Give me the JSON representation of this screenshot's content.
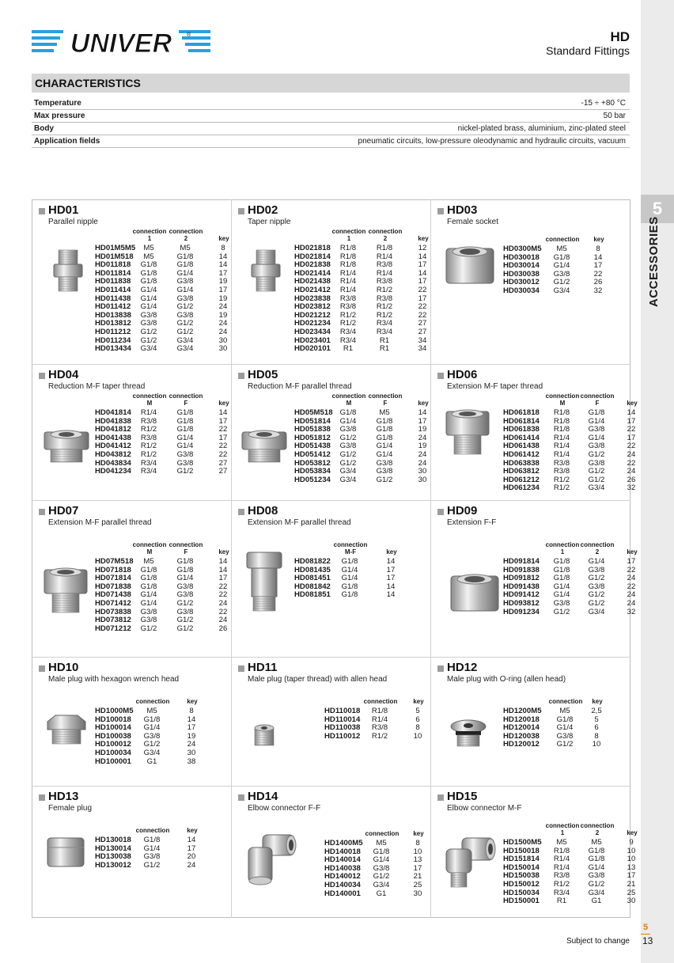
{
  "brand": "UNIVER",
  "header": {
    "series": "HD",
    "subtitle": "Standard Fittings"
  },
  "section_tab": {
    "number": "5",
    "label": "ACCESSORIES"
  },
  "characteristics": {
    "title": "CHARACTERISTICS",
    "rows": [
      {
        "label": "Temperature",
        "value": "-15 ÷ +80 °C"
      },
      {
        "label": "Max pressure",
        "value": "50 bar"
      },
      {
        "label": "Body",
        "value": "nickel-plated brass, aluminium, zinc-plated steel"
      },
      {
        "label": "Application fields",
        "value": "pneumatic circuits, low-pressure oleodynamic and hydraulic circuits, vacuum"
      }
    ]
  },
  "products": [
    {
      "code": "HD01",
      "desc": "Parallel nipple",
      "pic": "nipple",
      "header": [
        "",
        "connection\n1",
        "connection\n2",
        "key"
      ],
      "rows": [
        [
          "HD01M5M5",
          "M5",
          "M5",
          "8"
        ],
        [
          "HD01M518",
          "M5",
          "G1/8",
          "14"
        ],
        [
          "HD011818",
          "G1/8",
          "G1/8",
          "14"
        ],
        [
          "HD011814",
          "G1/8",
          "G1/4",
          "17"
        ],
        [
          "HD011838",
          "G1/8",
          "G3/8",
          "19"
        ],
        [
          "HD011414",
          "G1/4",
          "G1/4",
          "17"
        ],
        [
          "HD011438",
          "G1/4",
          "G3/8",
          "19"
        ],
        [
          "HD011412",
          "G1/4",
          "G1/2",
          "24"
        ],
        [
          "HD013838",
          "G3/8",
          "G3/8",
          "19"
        ],
        [
          "HD013812",
          "G3/8",
          "G1/2",
          "24"
        ],
        [
          "HD011212",
          "G1/2",
          "G1/2",
          "24"
        ],
        [
          "HD011234",
          "G1/2",
          "G3/4",
          "30"
        ],
        [
          "HD013434",
          "G3/4",
          "G3/4",
          "30"
        ]
      ]
    },
    {
      "code": "HD02",
      "desc": "Taper nipple",
      "pic": "nipple",
      "header": [
        "",
        "connection\n1",
        "connection\n2",
        "key"
      ],
      "rows": [
        [
          "HD021818",
          "R1/8",
          "R1/8",
          "12"
        ],
        [
          "HD021814",
          "R1/8",
          "R1/4",
          "14"
        ],
        [
          "HD021838",
          "R1/8",
          "R3/8",
          "17"
        ],
        [
          "HD021414",
          "R1/4",
          "R1/4",
          "14"
        ],
        [
          "HD021438",
          "R1/4",
          "R3/8",
          "17"
        ],
        [
          "HD021412",
          "R1/4",
          "R1/2",
          "22"
        ],
        [
          "HD023838",
          "R3/8",
          "R3/8",
          "17"
        ],
        [
          "HD023812",
          "R3/8",
          "R1/2",
          "22"
        ],
        [
          "HD021212",
          "R1/2",
          "R1/2",
          "22"
        ],
        [
          "HD021234",
          "R1/2",
          "R3/4",
          "27"
        ],
        [
          "HD023434",
          "R3/4",
          "R3/4",
          "27"
        ],
        [
          "HD023401",
          "R3/4",
          "R1",
          "34"
        ],
        [
          "HD020101",
          "R1",
          "R1",
          "34"
        ]
      ]
    },
    {
      "code": "HD03",
      "desc": "Female socket",
      "pic": "socket",
      "header": [
        "",
        "connection",
        "key"
      ],
      "rows": [
        [
          "HD0300M5",
          "M5",
          "8"
        ],
        [
          "HD030018",
          "G1/8",
          "14"
        ],
        [
          "HD030014",
          "G1/4",
          "17"
        ],
        [
          "HD030038",
          "G3/8",
          "22"
        ],
        [
          "HD030012",
          "G1/2",
          "26"
        ],
        [
          "HD030034",
          "G3/4",
          "32"
        ]
      ]
    },
    {
      "code": "HD04",
      "desc": "Reduction M-F taper thread",
      "pic": "reducer",
      "header": [
        "",
        "connection\nM",
        "connection\nF",
        "key"
      ],
      "rows": [
        [
          "HD041814",
          "R1/4",
          "G1/8",
          "14"
        ],
        [
          "HD041838",
          "R3/8",
          "G1/8",
          "17"
        ],
        [
          "HD041812",
          "R1/2",
          "G1/8",
          "22"
        ],
        [
          "HD041438",
          "R3/8",
          "G1/4",
          "17"
        ],
        [
          "HD041412",
          "R1/2",
          "G1/4",
          "22"
        ],
        [
          "HD043812",
          "R1/2",
          "G3/8",
          "22"
        ],
        [
          "HD043834",
          "R3/4",
          "G3/8",
          "27"
        ],
        [
          "HD041234",
          "R3/4",
          "G1/2",
          "27"
        ]
      ]
    },
    {
      "code": "HD05",
      "desc": "Reduction M-F parallel thread",
      "pic": "reducer",
      "header": [
        "",
        "connection\nM",
        "connection\nF",
        "key"
      ],
      "rows": [
        [
          "HD05M518",
          "G1/8",
          "M5",
          "14"
        ],
        [
          "HD051814",
          "G1/4",
          "G1/8",
          "17"
        ],
        [
          "HD051838",
          "G3/8",
          "G1/8",
          "19"
        ],
        [
          "HD051812",
          "G1/2",
          "G1/8",
          "24"
        ],
        [
          "HD051438",
          "G3/8",
          "G1/4",
          "19"
        ],
        [
          "HD051412",
          "G1/2",
          "G1/4",
          "24"
        ],
        [
          "HD053812",
          "G1/2",
          "G3/8",
          "24"
        ],
        [
          "HD053834",
          "G3/4",
          "G3/8",
          "30"
        ],
        [
          "HD051234",
          "G3/4",
          "G1/2",
          "30"
        ]
      ]
    },
    {
      "code": "HD06",
      "desc": "Extension M-F taper thread",
      "pic": "extension",
      "header": [
        "",
        "connection\nM",
        "connection\nF",
        "key"
      ],
      "rows": [
        [
          "HD061818",
          "R1/8",
          "G1/8",
          "14"
        ],
        [
          "HD061814",
          "R1/8",
          "G1/4",
          "17"
        ],
        [
          "HD061838",
          "R1/8",
          "G3/8",
          "22"
        ],
        [
          "HD061414",
          "R1/4",
          "G1/4",
          "17"
        ],
        [
          "HD061438",
          "R1/4",
          "G3/8",
          "22"
        ],
        [
          "HD061412",
          "R1/4",
          "G1/2",
          "24"
        ],
        [
          "HD063838",
          "R3/8",
          "G3/8",
          "22"
        ],
        [
          "HD063812",
          "R3/8",
          "G1/2",
          "24"
        ],
        [
          "HD061212",
          "R1/2",
          "G1/2",
          "26"
        ],
        [
          "HD061234",
          "R1/2",
          "G3/4",
          "32"
        ]
      ]
    },
    {
      "code": "HD07",
      "desc": "Extension M-F parallel thread",
      "pic": "extension",
      "header": [
        "",
        "connection\nM",
        "connection\nF",
        "key"
      ],
      "rows": [
        [
          "HD07M518",
          "M5",
          "G1/8",
          "14"
        ],
        [
          "HD071818",
          "G1/8",
          "G1/8",
          "14"
        ],
        [
          "HD071814",
          "G1/8",
          "G1/4",
          "17"
        ],
        [
          "HD071838",
          "G1/8",
          "G3/8",
          "22"
        ],
        [
          "HD071438",
          "G1/4",
          "G3/8",
          "22"
        ],
        [
          "HD071412",
          "G1/4",
          "G1/2",
          "24"
        ],
        [
          "HD073838",
          "G3/8",
          "G3/8",
          "22"
        ],
        [
          "HD073812",
          "G3/8",
          "G1/2",
          "24"
        ],
        [
          "HD071212",
          "G1/2",
          "G1/2",
          "26"
        ]
      ]
    },
    {
      "code": "HD08",
      "desc": "Extension M-F parallel thread",
      "pic": "long",
      "header": [
        "",
        "connection\nM-F",
        "key"
      ],
      "rows": [
        [
          "HD081822",
          "G1/8",
          "14"
        ],
        [
          "HD081435",
          "G1/4",
          "17"
        ],
        [
          "HD081451",
          "G1/4",
          "17"
        ],
        [
          "HD081842",
          "G1/8",
          "14"
        ],
        [
          "HD081851",
          "G1/8",
          "14"
        ]
      ]
    },
    {
      "code": "HD09",
      "desc": "Extension F-F",
      "pic": "socket",
      "header": [
        "",
        "connection\n1",
        "connection\n2",
        "key"
      ],
      "rows": [
        [
          "HD091814",
          "G1/8",
          "G1/4",
          "17"
        ],
        [
          "HD091838",
          "G1/8",
          "G3/8",
          "22"
        ],
        [
          "HD091812",
          "G1/8",
          "G1/2",
          "24"
        ],
        [
          "HD091438",
          "G1/4",
          "G3/8",
          "22"
        ],
        [
          "HD091412",
          "G1/4",
          "G1/2",
          "24"
        ],
        [
          "HD093812",
          "G3/8",
          "G1/2",
          "24"
        ],
        [
          "HD091234",
          "G1/2",
          "G3/4",
          "32"
        ]
      ]
    },
    {
      "code": "HD10",
      "desc": "Male plug with hexagon wrench head",
      "pic": "plug",
      "header": [
        "",
        "connection",
        "key"
      ],
      "rows": [
        [
          "HD1000M5",
          "M5",
          "8"
        ],
        [
          "HD100018",
          "G1/8",
          "14"
        ],
        [
          "HD100014",
          "G1/4",
          "17"
        ],
        [
          "HD100038",
          "G3/8",
          "19"
        ],
        [
          "HD100012",
          "G1/2",
          "24"
        ],
        [
          "HD100034",
          "G3/4",
          "30"
        ],
        [
          "HD100001",
          "G1",
          "38"
        ]
      ]
    },
    {
      "code": "HD11",
      "desc": "Male plug (taper thread) with allen head",
      "pic": "grub",
      "header": [
        "",
        "connection",
        "key"
      ],
      "rows": [
        [
          "HD110018",
          "R1/8",
          "5"
        ],
        [
          "HD110014",
          "R1/4",
          "6"
        ],
        [
          "HD110038",
          "R3/8",
          "8"
        ],
        [
          "HD110012",
          "R1/2",
          "10"
        ]
      ]
    },
    {
      "code": "HD12",
      "desc": "Male plug with O-ring (allen head)",
      "pic": "oring",
      "header": [
        "",
        "connection",
        "key"
      ],
      "rows": [
        [
          "HD1200M5",
          "M5",
          "2,5"
        ],
        [
          "HD120018",
          "G1/8",
          "5"
        ],
        [
          "HD120014",
          "G1/4",
          "6"
        ],
        [
          "HD120038",
          "G3/8",
          "8"
        ],
        [
          "HD120012",
          "G1/2",
          "10"
        ]
      ]
    },
    {
      "code": "HD13",
      "desc": "Female plug",
      "pic": "cap",
      "header": [
        "",
        "connection",
        "key"
      ],
      "rows": [
        [
          "HD130018",
          "G1/8",
          "14"
        ],
        [
          "HD130014",
          "G1/4",
          "17"
        ],
        [
          "HD130038",
          "G3/8",
          "20"
        ],
        [
          "HD130012",
          "G1/2",
          "24"
        ]
      ]
    },
    {
      "code": "HD14",
      "desc": "Elbow connector F-F",
      "pic": "elbowff",
      "header": [
        "",
        "connection",
        "key"
      ],
      "rows": [
        [
          "HD1400M5",
          "M5",
          "8"
        ],
        [
          "HD140018",
          "G1/8",
          "10"
        ],
        [
          "HD140014",
          "G1/4",
          "13"
        ],
        [
          "HD140038",
          "G3/8",
          "17"
        ],
        [
          "HD140012",
          "G1/2",
          "21"
        ],
        [
          "HD140034",
          "G3/4",
          "25"
        ],
        [
          "HD140001",
          "G1",
          "30"
        ]
      ]
    },
    {
      "code": "HD15",
      "desc": "Elbow connector M-F",
      "pic": "elbowmf",
      "header": [
        "",
        "connection\n1",
        "connection\n2",
        "key"
      ],
      "rows": [
        [
          "HD1500M5",
          "M5",
          "M5",
          "9"
        ],
        [
          "HD150018",
          "R1/8",
          "G1/8",
          "10"
        ],
        [
          "HD151814",
          "R1/4",
          "G1/8",
          "10"
        ],
        [
          "HD150014",
          "R1/4",
          "G1/4",
          "13"
        ],
        [
          "HD150038",
          "R3/8",
          "G3/8",
          "17"
        ],
        [
          "HD150012",
          "R1/2",
          "G1/2",
          "21"
        ],
        [
          "HD150034",
          "R3/4",
          "G3/4",
          "25"
        ],
        [
          "HD150001",
          "R1",
          "G1",
          "30"
        ]
      ]
    }
  ],
  "footer": {
    "section_number": "5",
    "note": "Subject to change",
    "page": "13"
  }
}
